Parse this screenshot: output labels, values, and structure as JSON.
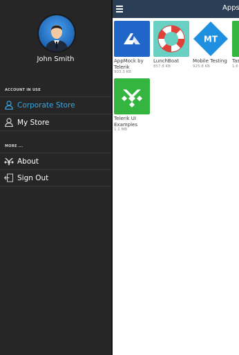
{
  "user": {
    "name": "John Smith"
  },
  "drawer": {
    "account_section": "ACCOUNT IN USE",
    "more_section": "MORE ...",
    "accounts": [
      {
        "label": "Corporate Store",
        "active": true
      },
      {
        "label": "My Store",
        "active": false
      }
    ],
    "more_items": [
      {
        "label": "About"
      },
      {
        "label": "Sign Out"
      }
    ]
  },
  "topbar": {
    "title": "Apps"
  },
  "apps": [
    {
      "name": "AppMock by Telerik",
      "size": "903.3 KB",
      "tile_color": "#1f66c8",
      "icon": "appmock-logo-icon"
    },
    {
      "name": "LunchBoat",
      "size": "857.8 KB",
      "tile_color": "#6ad0c4",
      "icon": "lifebuoy-icon"
    },
    {
      "name": "Mobile Testing",
      "size": "925.8 KB",
      "tile_color": "#ffffff",
      "icon": "mt-diamond-icon",
      "icon_text": "MT"
    },
    {
      "name": "Tas",
      "size": "1.6",
      "tile_color": "#33b540",
      "icon": "partial-tile-icon"
    },
    {
      "name": "Telerik UI Examples",
      "size": "1.1 MB",
      "tile_color": "#33b540",
      "icon": "telerik-logo-icon"
    }
  ],
  "colors": {
    "accent": "#3aa7e0",
    "topbar": "#2a3f55",
    "drawer": "#262626"
  }
}
